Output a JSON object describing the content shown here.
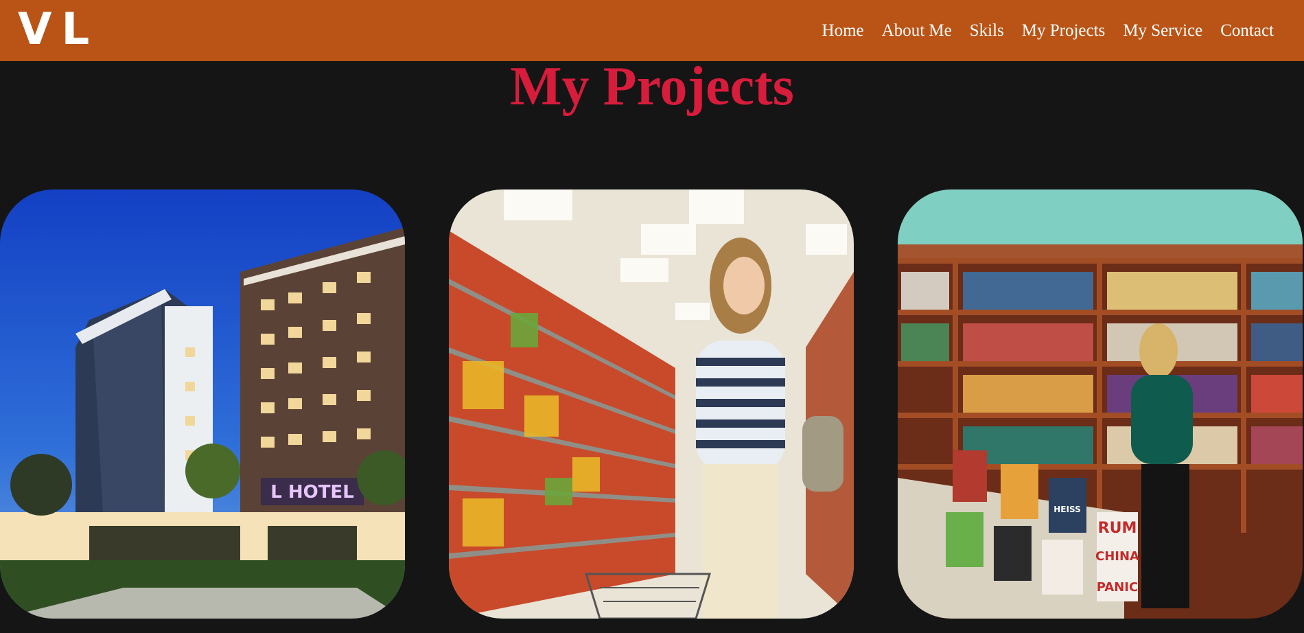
{
  "header": {
    "logo": "VL",
    "nav": [
      {
        "label": "Home"
      },
      {
        "label": "About Me"
      },
      {
        "label": "Skils"
      },
      {
        "label": "My Projects"
      },
      {
        "label": "My Service"
      },
      {
        "label": "Contact"
      }
    ]
  },
  "main": {
    "title": "My Projects",
    "projects": [
      {
        "image": "hotel-building-photo",
        "sign_text": "L HOTEL"
      },
      {
        "image": "supermarket-shopper-photo"
      },
      {
        "image": "bookstore-photo",
        "book_texts": [
          "RUM",
          "CHINA",
          "PANIC",
          "HEISS"
        ]
      }
    ]
  },
  "colors": {
    "navbar_bg": "#b95416",
    "page_bg": "#151515",
    "title": "#d81c3c",
    "nav_text": "#ffffff"
  }
}
